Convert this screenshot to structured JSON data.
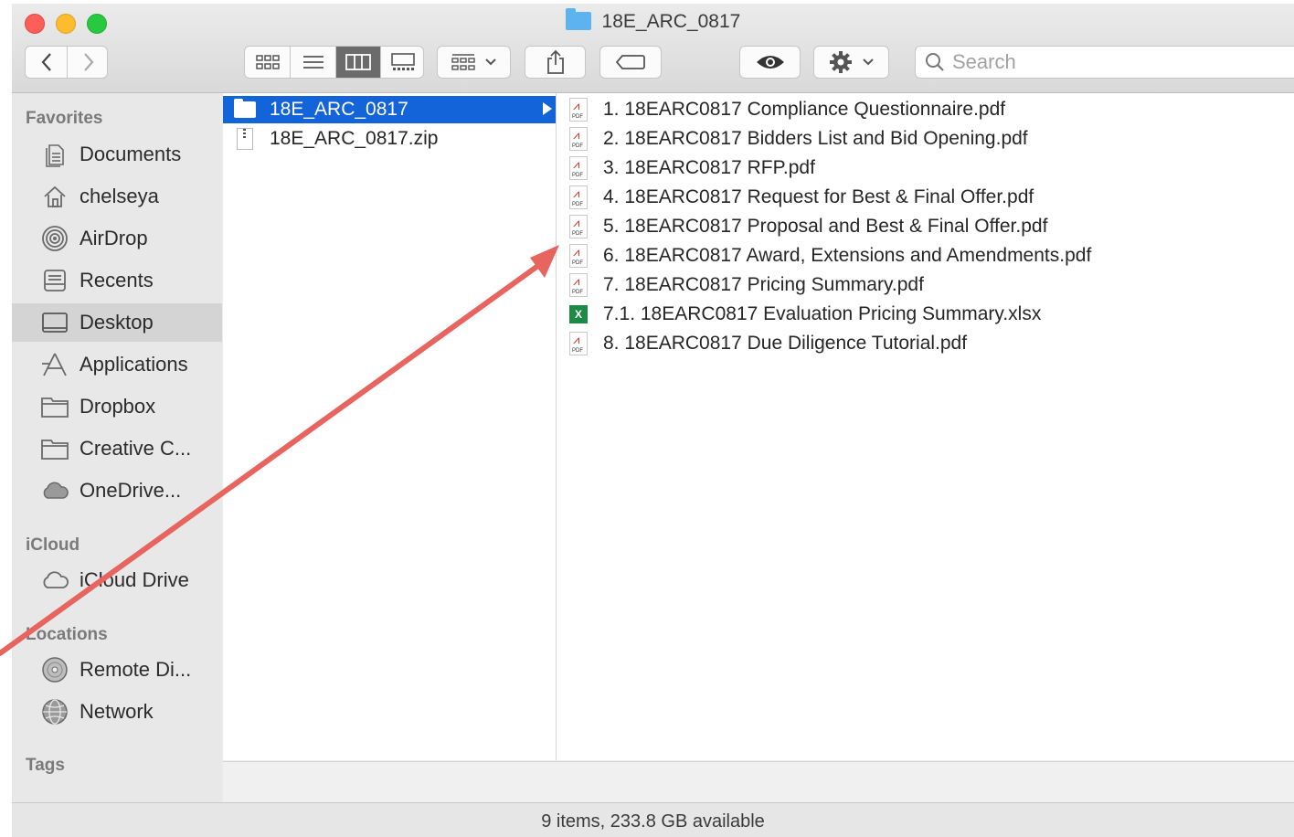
{
  "window": {
    "title": "18E_ARC_0817"
  },
  "toolbar": {
    "back_icon": "chevron-left-icon",
    "forward_icon": "chevron-right-icon",
    "view_modes": [
      "icon-view",
      "list-view",
      "column-view",
      "gallery-view"
    ],
    "active_view": "column-view",
    "search_placeholder": "Search"
  },
  "sidebar": {
    "sections": [
      {
        "label": "Favorites"
      },
      {
        "label": "iCloud"
      },
      {
        "label": "Locations"
      },
      {
        "label": "Tags"
      }
    ],
    "items": [
      {
        "label": "Documents",
        "icon": "documents-icon"
      },
      {
        "label": "chelseya",
        "icon": "home-icon"
      },
      {
        "label": "AirDrop",
        "icon": "airdrop-icon"
      },
      {
        "label": "Recents",
        "icon": "recents-icon"
      },
      {
        "label": "Desktop",
        "icon": "desktop-icon",
        "selected": true
      },
      {
        "label": "Applications",
        "icon": "applications-icon"
      },
      {
        "label": "Dropbox",
        "icon": "folder-icon"
      },
      {
        "label": "Creative C...",
        "icon": "folder-icon"
      },
      {
        "label": "OneDrive...",
        "icon": "cloud-icon"
      },
      {
        "label": "iCloud Drive",
        "icon": "cloud-icon"
      },
      {
        "label": "Remote Di...",
        "icon": "disc-icon"
      },
      {
        "label": "Network",
        "icon": "network-icon"
      }
    ]
  },
  "column1": [
    {
      "name": "18E_ARC_0817",
      "type": "folder",
      "selected": true
    },
    {
      "name": "18E_ARC_0817.zip",
      "type": "zip"
    }
  ],
  "column2": [
    {
      "name": "1. 18EARC0817 Compliance Questionnaire.pdf",
      "type": "pdf"
    },
    {
      "name": "2. 18EARC0817 Bidders List and Bid Opening.pdf",
      "type": "pdf"
    },
    {
      "name": "3. 18EARC0817 RFP.pdf",
      "type": "pdf"
    },
    {
      "name": "4. 18EARC0817 Request for Best & Final Offer.pdf",
      "type": "pdf"
    },
    {
      "name": "5. 18EARC0817 Proposal and Best & Final Offer.pdf",
      "type": "pdf"
    },
    {
      "name": "6. 18EARC0817 Award, Extensions and Amendments.pdf",
      "type": "pdf"
    },
    {
      "name": "7. 18EARC0817 Pricing Summary.pdf",
      "type": "pdf"
    },
    {
      "name": "7.1. 18EARC0817 Evaluation Pricing Summary.xlsx",
      "type": "xlsx"
    },
    {
      "name": "8. 18EARC0817 Due Diligence Tutorial.pdf",
      "type": "pdf"
    }
  ],
  "status": {
    "text": "9 items, 233.8 GB available"
  },
  "colors": {
    "selection": "#1464d9",
    "annotation_arrow": "#e8645e",
    "folder_blue": "#5cb3ef"
  }
}
